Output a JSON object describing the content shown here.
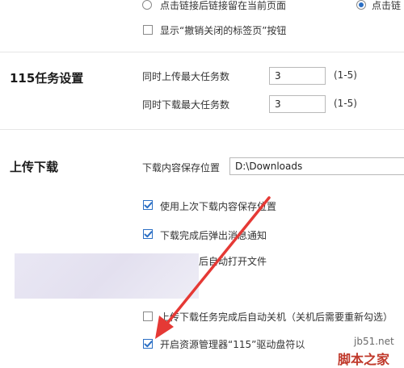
{
  "top_options": {
    "radio_left_label": "点击链接后链接留在当前页面",
    "radio_right_label": "点击链",
    "radio_right_selected": true,
    "show_undo_closed_tabs_label": "显示“撤销关闭的标签页”按钮",
    "show_undo_closed_tabs_checked": false
  },
  "task_settings": {
    "title": "115任务设置",
    "max_upload_label": "同时上传最大任务数",
    "max_upload_value": "3",
    "max_upload_range": "(1-5)",
    "max_download_label": "同时下载最大任务数",
    "max_download_value": "3",
    "max_download_range": "(1-5)"
  },
  "upload_download": {
    "title": "上传下载",
    "save_location_label": "下载内容保存位置",
    "save_location_value": "D:\\Downloads",
    "use_last_location_label": "使用上次下载内容保存位置",
    "use_last_location_checked": true,
    "popup_on_complete_label": "下载完成后弹出消息通知",
    "popup_on_complete_checked": true,
    "auto_open_label": "后自动打开文件",
    "shutdown_label": "上传下载任务完成后自动关机（关机后需要重新勾选）",
    "shutdown_checked": false,
    "explorer_drive_label": "开启资源管理器“115”驱动盘符以",
    "explorer_drive_checked": true
  },
  "watermark": {
    "site": "jb51.net",
    "name": "脚本之家"
  },
  "colors": {
    "accent": "#2b6fc4",
    "arrow": "#e53935"
  }
}
